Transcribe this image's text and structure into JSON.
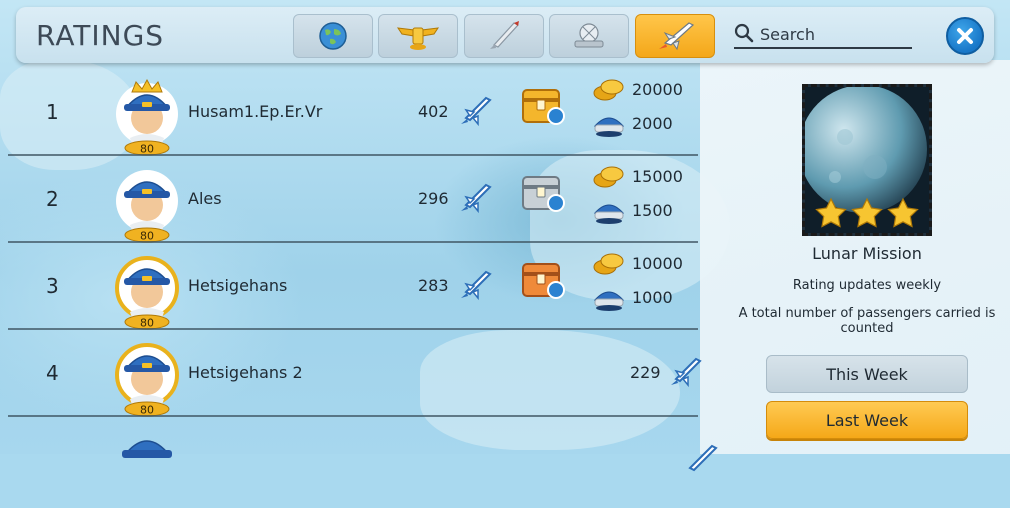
{
  "header": {
    "title": "RATINGS",
    "tabs": [
      {
        "icon": "globe-icon",
        "active": false
      },
      {
        "icon": "wings-badge-icon",
        "active": false
      },
      {
        "icon": "rocket-icon",
        "active": false
      },
      {
        "icon": "satellite-icon",
        "active": false
      },
      {
        "icon": "space-shuttle-icon",
        "active": true
      }
    ],
    "search": {
      "label": "Search",
      "icon": "search-icon"
    },
    "close_icon": "close-icon"
  },
  "rows": [
    {
      "rank": "1",
      "name": "Husam1.Ep.Er.Vr",
      "level": "80",
      "score": "402",
      "chest": "gold",
      "coins": "20000",
      "caps": "2000",
      "crown": true
    },
    {
      "rank": "2",
      "name": "Ales",
      "level": "80",
      "score": "296",
      "chest": "silver",
      "coins": "15000",
      "caps": "1500",
      "crown": false
    },
    {
      "rank": "3",
      "name": "Hetsigehans",
      "level": "80",
      "score": "283",
      "chest": "bronze",
      "coins": "10000",
      "caps": "1000",
      "crown": false
    },
    {
      "rank": "4",
      "name": "Hetsigehans 2",
      "level": "80",
      "score": "229",
      "chest": "",
      "coins": "",
      "caps": "",
      "crown": false
    }
  ],
  "side_panel": {
    "mission_name": "Lunar Mission",
    "stars": 3,
    "rating_note": "Rating updates weekly",
    "count_note": "A total number of passengers carried is counted",
    "this_week_label": "This Week",
    "last_week_label": "Last Week",
    "selected": "Last Week"
  },
  "colors": {
    "accent_orange": "#f5a818",
    "close_blue": "#1877c8",
    "text_dark": "#1f2a33"
  }
}
